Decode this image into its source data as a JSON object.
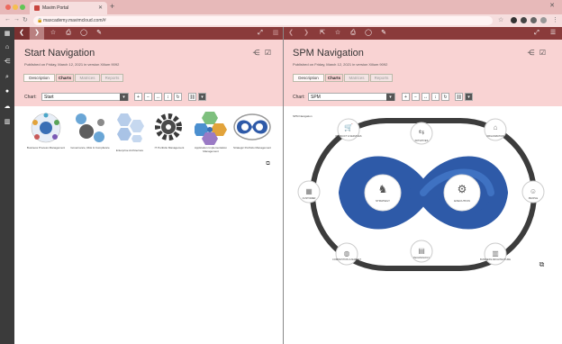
{
  "browser": {
    "tab_title": "Mavim Portal",
    "url": "maxcademy.mavimcloud.com/#"
  },
  "left_pane": {
    "title": "Start Navigation",
    "published": "Published on Friday, March 12, 2021 in version Xilium 9092",
    "tabs": [
      "Description",
      "Charts",
      "Matrices",
      "Reports"
    ],
    "chart_label": "Chart:",
    "chart_value": "Start",
    "zoom_controls": [
      "+",
      "−",
      "↔",
      "↕"
    ],
    "items": [
      "Business Process Management",
      "Governance, Risk & Compliance",
      "Enterprise Architecture",
      "IT Portfolio Management",
      "Application Implementation Management",
      "Strategic Portfolio Management"
    ]
  },
  "right_pane": {
    "title": "SPM Navigation",
    "published": "Published on Friday, March 12, 2021 in version Xilium 9092",
    "tabs": [
      "Description",
      "Charts",
      "Matrices",
      "Reports"
    ],
    "chart_label": "Chart:",
    "chart_value": "SPM",
    "zoom_controls": [
      "+",
      "−",
      "↔",
      "↕"
    ],
    "diagram_label": "SPM Navigation",
    "center_left": "STRATEGY",
    "center_right": "EXECUTION",
    "nodes": {
      "top_left": "PRODUCT & SERVICES",
      "top_center": "INITIATIVES",
      "top_right": "ORGANIZATION",
      "left": "CUSTOMER",
      "right": "PEOPLE",
      "bottom_left": "COMPETITION & MARKET",
      "bottom_center": "TECHNOLOGY",
      "bottom_right": "BUSINESS ARCHITECTURE"
    }
  },
  "colors": {
    "toolbar": "#8a3b3b",
    "pane_header": "#f9d3d3",
    "infinity_blue": "#2e5aa8",
    "ring": "#3c3c3c"
  }
}
